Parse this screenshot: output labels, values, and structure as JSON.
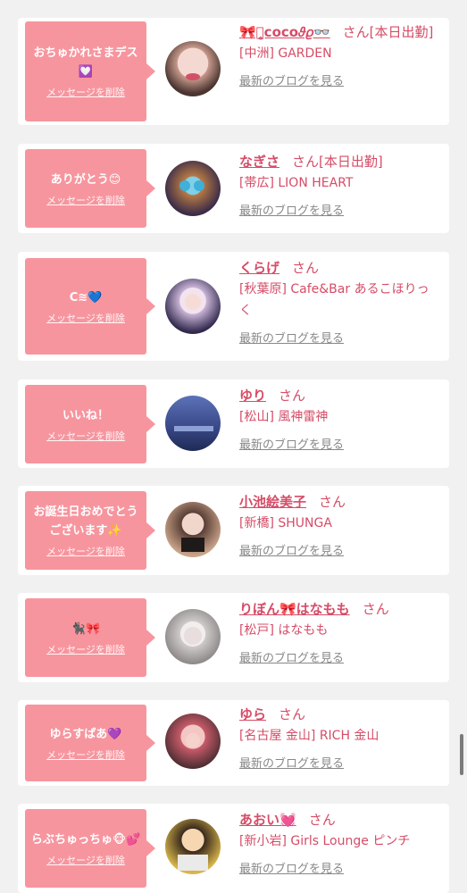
{
  "delete_label": "メッセージを削除",
  "blog_label": "最新のブログを見る",
  "honorific": "さん",
  "items": [
    {
      "message": "おちゅかれさまデス💟",
      "name": "🎀ꪔ̤̥coco𝜗𝜚👓",
      "suffix": "[本日出勤]",
      "shop": "[中洲] GARDEN"
    },
    {
      "message": "ありがとう😊",
      "name": "なぎさ",
      "suffix": "[本日出勤]",
      "shop": "[帯広] LION HEART"
    },
    {
      "message": "C≋💙",
      "name": "くらげ",
      "suffix": "",
      "shop": "[秋葉原] Cafe&Bar あるこほりっく"
    },
    {
      "message": "いいね！",
      "name": "ゆり",
      "suffix": "",
      "shop": "[松山] 風神雷神"
    },
    {
      "message": "お誕生日おめでとうございます✨",
      "name": "小池絵美子",
      "suffix": "",
      "shop": "[新橋] SHUNGA"
    },
    {
      "message": "🐈‍⬛🎀",
      "name": "りぼん🎀はなもも",
      "suffix": "",
      "shop": "[松戸] はなもも"
    },
    {
      "message": "ゆらすぱあ💜",
      "name": "ゆら",
      "suffix": "",
      "shop": "[名古屋 金山] RICH 金山"
    },
    {
      "message": "らぶちゅっちゅ🐵💕",
      "name": "あおい💓",
      "suffix": "",
      "shop": "[新小岩] Girls Lounge ピンチ"
    }
  ]
}
